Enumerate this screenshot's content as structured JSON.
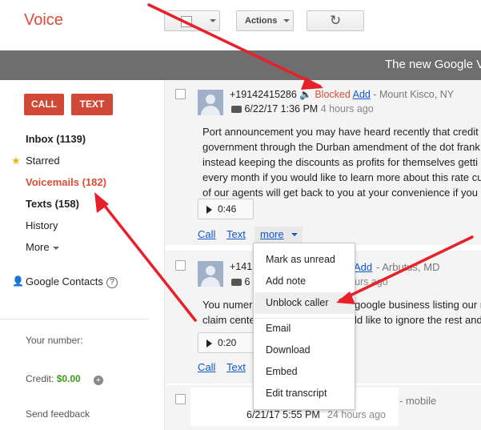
{
  "app": {
    "logo": "Voice"
  },
  "toolbar": {
    "actions_label": "Actions"
  },
  "banner": {
    "text": "The new Google V"
  },
  "sidebar": {
    "call_label": "CALL",
    "text_label": "TEXT",
    "nav": {
      "inbox": "Inbox (1139)",
      "starred": "Starred",
      "voicemails": "Voicemails (182)",
      "texts": "Texts (158)",
      "history": "History",
      "more": "More"
    },
    "contacts": "Google Contacts",
    "your_number_label": "Your number:",
    "credit_label": "Credit:",
    "credit_value": "$0.00",
    "send_feedback": "Send feedback"
  },
  "messages": [
    {
      "phone": "+19142415286",
      "blocked": "Blocked",
      "add": "Add",
      "location": "- Mount Kisco, NY",
      "timestamp": "6/22/17 1:36 PM",
      "ago": "4 hours ago",
      "transcript": [
        "Port announcement you may have heard recently that credit",
        "government through the Durban amendment of the dot frank",
        "instead keeping the discounts as profits for themselves getti",
        "every month if you would like to learn more about this rate cu",
        "of our agents will get back to you at your convenience if you"
      ],
      "duration": "0:46",
      "call_link": "Call",
      "text_link": "Text",
      "more_link": "more"
    },
    {
      "phone": "+141",
      "add": "Add",
      "location": "- Arbutus, MD",
      "timestamp": "6",
      "ago": "urs ago",
      "transcript": [
        "You numero",
        "claim cente"
      ],
      "transcript_tail": [
        "google business listing our r",
        "ld like to ignore the rest and"
      ],
      "duration": "0:20",
      "call_link": "Call",
      "text_link": "Text"
    },
    {
      "location": "- mobile",
      "timestamp": "6/21/17 5:55 PM",
      "ago": "24 hours ago"
    }
  ],
  "menu": {
    "items": [
      "Mark as unread",
      "Add note",
      "Unblock caller",
      "Email",
      "Download",
      "Embed",
      "Edit transcript"
    ],
    "highlighted": "Unblock caller"
  },
  "icons": {
    "refresh": "refresh-icon",
    "star": "star-icon",
    "speaker": "speaker-icon",
    "voicemail": "voicemail-icon",
    "play": "play-icon",
    "person": "person-icon",
    "help": "help-icon",
    "plus": "plus-circle-icon"
  },
  "colors": {
    "brand_red": "#dd4b39",
    "button_red": "#d14836",
    "link_blue": "#1155cc",
    "credit_green": "#3b9a1a",
    "banner_gray": "#6e6e6e",
    "annotation_red": "#e8202a"
  }
}
